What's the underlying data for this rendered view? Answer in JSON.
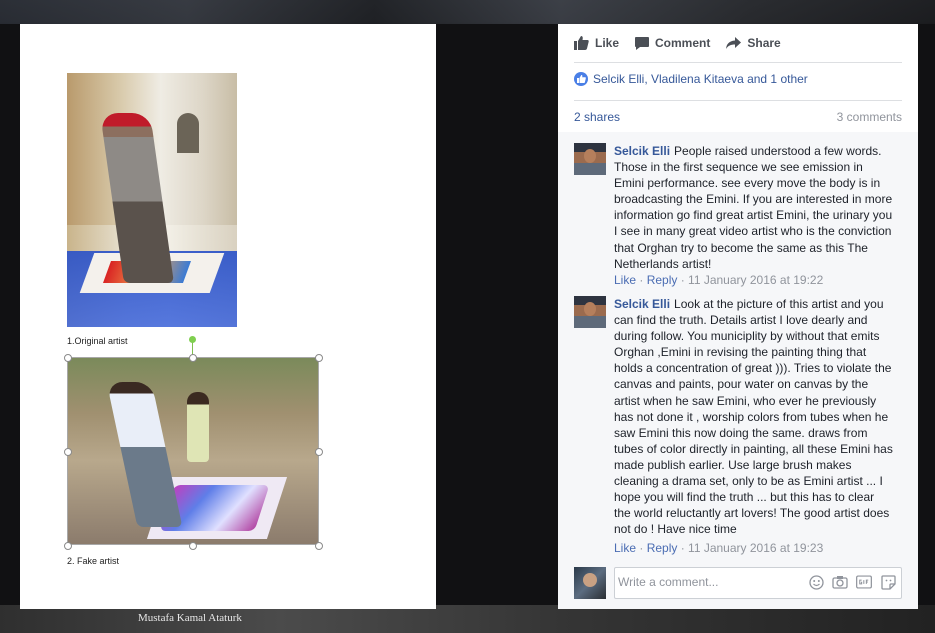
{
  "photo": {
    "caption_original": "1.Original artist",
    "caption_fake": "2. Fake artist",
    "bottom_caption": "Mustafa Kamal Ataturk"
  },
  "actions": {
    "like": "Like",
    "comment": "Comment",
    "share": "Share"
  },
  "reactions": {
    "text": "Selcik Elli, Vladilena Kitaeva and 1 other"
  },
  "stats": {
    "shares": "2 shares",
    "comments": "3 comments"
  },
  "comments": [
    {
      "author": "Selcik Elli",
      "text": "People raised understood a few words. Those in the first sequence we see emission in Emini performance. see every move the body is in broadcasting the Emini. If you are interested in more information go find great artist Emini, the urinary you I see in many great video artist who is the conviction that Orghan try to become the same as this The Netherlands artist!",
      "like": "Like",
      "reply": "Reply",
      "time": "11 January 2016 at 19:22"
    },
    {
      "author": "Selcik Elli",
      "text": "Look at the picture of this artist and you can find the truth. Details artist I love dearly and during follow. You municiplity by without that emits Orghan ,Emini in revising the painting thing that holds a concentration of great ))). Tries to violate the canvas and paints, pour water on canvas by the artist when he saw Emini, who ever he previously has not done it , worship colors from tubes when he saw Emini this now doing the same. draws from tubes of color directly in painting, all these Emini has made publish earlier. Use large brush makes cleaning a drama set, only to be as Emini artist ... I hope you will find the truth ... but this has to clear the world reluctantly art lovers! The good artist does not do ! Have nice time",
      "like": "Like",
      "reply": "Reply",
      "time": "11 January 2016 at 19:23"
    }
  ],
  "composer": {
    "placeholder": "Write a comment..."
  },
  "colors": {
    "link": "#365899",
    "meta": "#90949c",
    "accent": "#4a7fe6"
  }
}
